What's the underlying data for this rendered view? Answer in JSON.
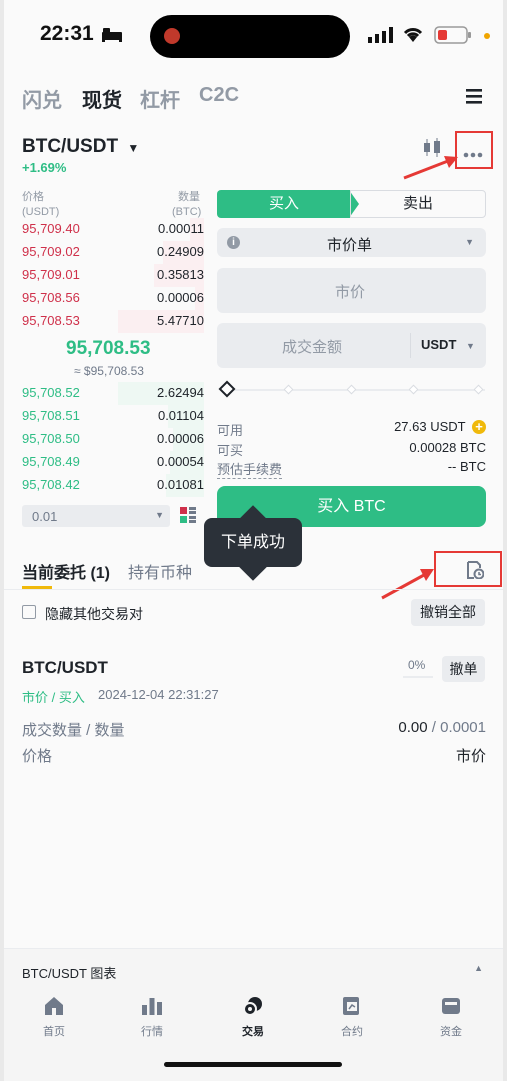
{
  "status_bar": {
    "time": "22:31"
  },
  "header": {
    "tabs": [
      "闪兑",
      "现货",
      "杠杆",
      "C2C"
    ],
    "active_tab": "现货"
  },
  "market": {
    "pair": "BTC/USDT",
    "change": "+1.69%"
  },
  "orderbook": {
    "price_header": "价格",
    "price_unit": "(USDT)",
    "qty_header": "数量",
    "qty_unit": "(BTC)",
    "asks": [
      {
        "price": "95,709.40",
        "qty": "0.00011",
        "depth": 0.15
      },
      {
        "price": "95,709.02",
        "qty": "0.24909",
        "depth": 0.45
      },
      {
        "price": "95,709.01",
        "qty": "0.35813",
        "depth": 0.55
      },
      {
        "price": "95,708.56",
        "qty": "0.00006",
        "depth": 0.1
      },
      {
        "price": "95,708.53",
        "qty": "5.47710",
        "depth": 0.95
      }
    ],
    "mid_price": "95,708.53",
    "mid_sub": "≈ $95,708.53",
    "bids": [
      {
        "price": "95,708.52",
        "qty": "2.62494",
        "depth": 0.95
      },
      {
        "price": "95,708.51",
        "qty": "0.01104",
        "depth": 0.4
      },
      {
        "price": "95,708.50",
        "qty": "0.00006",
        "depth": 0.35
      },
      {
        "price": "95,708.49",
        "qty": "0.00054",
        "depth": 0.38
      },
      {
        "price": "95,708.42",
        "qty": "0.01081",
        "depth": 0.42
      }
    ],
    "precision": "0.01"
  },
  "trade_form": {
    "buy_label": "买入",
    "sell_label": "卖出",
    "order_type": "市价单",
    "price_placeholder": "市价",
    "amount_placeholder": "成交金额",
    "amount_unit": "USDT",
    "available_label": "可用",
    "available_value": "27.63 USDT",
    "can_buy_label": "可买",
    "can_buy_value": "0.00028 BTC",
    "fee_label": "预估手续费",
    "fee_value": "-- BTC",
    "submit_label": "买入 BTC"
  },
  "toast": "下单成功",
  "orders": {
    "tab_open": "当前委托 (1)",
    "tab_holdings": "持有币种",
    "hide_others": "隐藏其他交易对",
    "cancel_all": "撤销全部",
    "order": {
      "pair": "BTC/USDT",
      "type": "市价 / 买入",
      "time": "2024-12-04 22:31:27",
      "progress": "0%",
      "cancel": "撤单",
      "filled_label": "成交数量 / 数量",
      "filled_value": "0.00",
      "filled_total": "/ 0.0001",
      "price_label": "价格",
      "price_value": "市价"
    }
  },
  "chart_bar": {
    "label": "BTC/USDT 图表"
  },
  "bottom_nav": [
    "首页",
    "行情",
    "交易",
    "合约",
    "资金"
  ],
  "colors": {
    "green": "#2ebd85",
    "red": "#cf304a",
    "annotation": "#e53935"
  }
}
